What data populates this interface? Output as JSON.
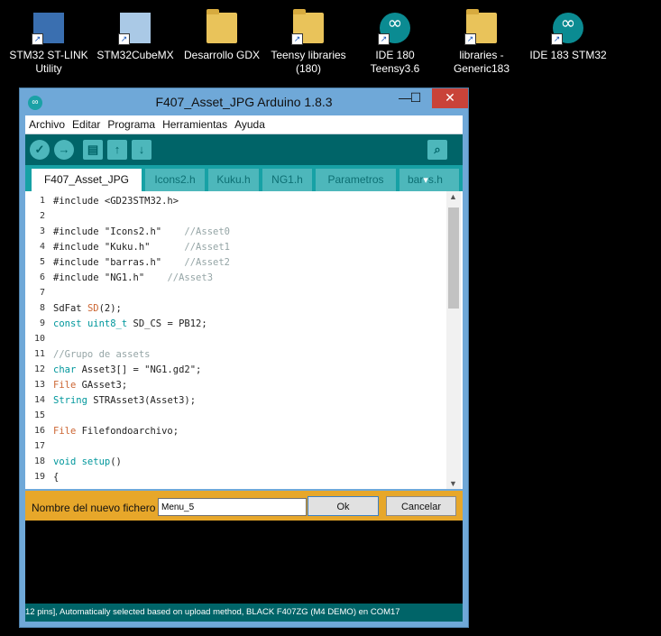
{
  "desktop": {
    "icons": [
      {
        "label_1": "STM32 ST-LINK",
        "label_2": "Utility",
        "icon": "stlink-app-icon"
      },
      {
        "label_1": "STM32CubeMX",
        "label_2": "",
        "icon": "cube-app-icon"
      },
      {
        "label_1": "Desarrollo GDX",
        "label_2": "",
        "icon": "folder-icon"
      },
      {
        "label_1": "Teensy libraries",
        "label_2": "(180)",
        "icon": "folder-icon"
      },
      {
        "label_1": "IDE 180",
        "label_2": "Teensy3.6",
        "icon": "arduino-icon"
      },
      {
        "label_1": "libraries -",
        "label_2": "Generic183",
        "icon": "folder-icon"
      },
      {
        "label_1": "IDE 183 STM32",
        "label_2": "",
        "icon": "arduino-icon"
      }
    ]
  },
  "window": {
    "title": "F407_Asset_JPG Arduino 1.8.3",
    "min": "—",
    "max": "☐",
    "close": "✕"
  },
  "menu": [
    "Archivo",
    "Editar",
    "Programa",
    "Herramientas",
    "Ayuda"
  ],
  "toolbar": {
    "verify": "✓",
    "upload": "→",
    "new": "▤",
    "open": "↑",
    "save": "↓",
    "monitor": "⌕"
  },
  "tabs": [
    "F407_Asset_JPG",
    "Icons2.h",
    "Kuku.h",
    "NG1.h",
    "Parametros",
    "bar"
  ],
  "tab_more": "▾",
  "tab_overflow": "s.h",
  "editor": {
    "line_numbers": [
      "1",
      "2",
      "3",
      "4",
      "5",
      "6",
      "7",
      "8",
      "9",
      "10",
      "11",
      "12",
      "13",
      "14",
      "15",
      "16",
      "17",
      "18",
      "19"
    ],
    "lines": [
      [
        {
          "t": "#include <GD23STM32.h>",
          "c": ""
        }
      ],
      [],
      [
        {
          "t": "#include \"Icons2.h\"    ",
          "c": ""
        },
        {
          "t": "//Asset0",
          "c": "c"
        }
      ],
      [
        {
          "t": "#include \"Kuku.h\"      ",
          "c": ""
        },
        {
          "t": "//Asset1",
          "c": "c"
        }
      ],
      [
        {
          "t": "#include \"barras.h\"    ",
          "c": ""
        },
        {
          "t": "//Asset2",
          "c": "c"
        }
      ],
      [
        {
          "t": "#include \"NG1.h\"    ",
          "c": ""
        },
        {
          "t": "//Asset3",
          "c": "c"
        }
      ],
      [],
      [
        {
          "t": "SdFat ",
          "c": ""
        },
        {
          "t": "SD",
          "c": "ty"
        },
        {
          "t": "(2);",
          "c": ""
        }
      ],
      [
        {
          "t": "const ",
          "c": "kw"
        },
        {
          "t": "uint8_t",
          "c": "kw"
        },
        {
          "t": " SD_CS = PB12;",
          "c": ""
        }
      ],
      [],
      [
        {
          "t": "//Grupo de assets",
          "c": "c"
        }
      ],
      [
        {
          "t": "char ",
          "c": "kw"
        },
        {
          "t": "Asset3[] = \"NG1.gd2\";",
          "c": ""
        }
      ],
      [
        {
          "t": "File ",
          "c": "ty"
        },
        {
          "t": "GAsset3;",
          "c": ""
        }
      ],
      [
        {
          "t": "String ",
          "c": "kw"
        },
        {
          "t": "STRAsset3(Asset3);",
          "c": ""
        }
      ],
      [],
      [
        {
          "t": "File ",
          "c": "ty"
        },
        {
          "t": "Filefondoarchivo;",
          "c": ""
        }
      ],
      [],
      [
        {
          "t": "void ",
          "c": "kw"
        },
        {
          "t": "setup",
          "c": "kw"
        },
        {
          "t": "()",
          "c": ""
        }
      ],
      [
        {
          "t": "{",
          "c": ""
        }
      ]
    ]
  },
  "dialog": {
    "label": "Nombre del nuevo fichero",
    "value": "Menu_5",
    "ok": "Ok",
    "cancel": "Cancelar"
  },
  "status": "12 pins], Automatically selected based on upload method, BLACK F407ZG (M4 DEMO) en COM17"
}
